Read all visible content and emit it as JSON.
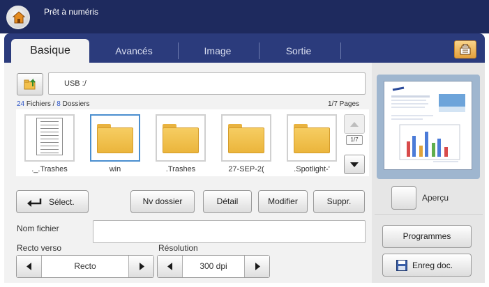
{
  "header": {
    "title": "Prêt à numéris"
  },
  "tabs": [
    {
      "label": "Basique"
    },
    {
      "label": "Avancés"
    },
    {
      "label": "Image"
    },
    {
      "label": "Sortie"
    }
  ],
  "browser": {
    "path": "USB :/",
    "files_count": "24",
    "files_label": " Fichiers / ",
    "folders_count": "8",
    "folders_label": " Dossiers",
    "pages": "1/7 Pages",
    "scroll_page": "1/7",
    "items": [
      {
        "label": "._.Trashes",
        "kind": "document"
      },
      {
        "label": "win",
        "kind": "folder"
      },
      {
        "label": ".Trashes",
        "kind": "folder"
      },
      {
        "label": "27-SEP-2(",
        "kind": "folder"
      },
      {
        "label": ".Spotlight-'",
        "kind": "folder"
      }
    ]
  },
  "actions": {
    "select": "Sélect.",
    "new_folder": "Nv dossier",
    "detail": "Détail",
    "modify": "Modifier",
    "delete": "Suppr."
  },
  "form": {
    "filename_label": "Nom fichier",
    "filename_value": "",
    "duplex_label": "Recto verso",
    "duplex_value": "Recto",
    "resolution_label": "Résolution",
    "resolution_value": "300 dpi"
  },
  "side": {
    "preview_label": "Aperçu",
    "programs": "Programmes",
    "save_doc": "Enreg doc."
  },
  "colors": {
    "title_bar": "#1e2a5e",
    "tab_bar": "#2b3b7c",
    "selection": "#4a8ecf",
    "folder": "#f6cd62",
    "count_highlight": "#2e56c7"
  }
}
